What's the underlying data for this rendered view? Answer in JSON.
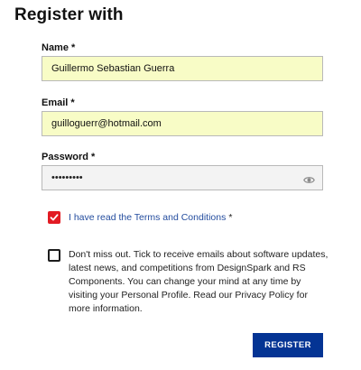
{
  "form": {
    "title": "Register with",
    "required_mark": "*",
    "name": {
      "label": "Name",
      "value": "Guillermo Sebastian Guerra"
    },
    "email": {
      "label": "Email",
      "value": "guilloguerr@hotmail.com"
    },
    "password": {
      "label": "Password",
      "value": "•••••••••",
      "toggle_icon": "eye-icon"
    },
    "terms": {
      "checked": true,
      "label": "I have read the Terms and Conditions",
      "required_mark": "*"
    },
    "marketing": {
      "checked": false,
      "text": "Don't miss out. Tick to receive emails about software updates, latest news, and competitions from DesignSpark and RS Components. You can change your mind at any time by visiting your Personal Profile. Read our Privacy Policy for more information."
    },
    "submit_label": "REGISTER"
  },
  "colors": {
    "autofill_bg": "#f8fcc6",
    "checkbox_accent": "#e21b23",
    "link_text": "#234c9e",
    "button_bg": "#043494"
  }
}
